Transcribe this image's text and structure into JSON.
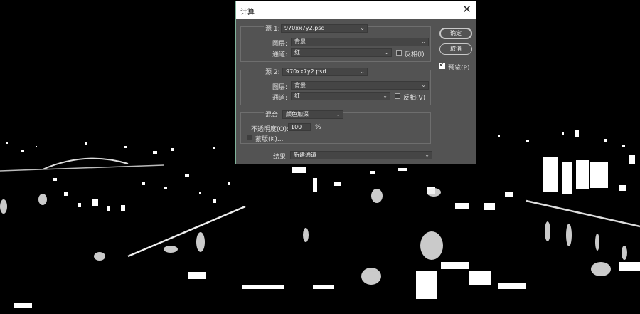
{
  "dialog": {
    "title": "计算",
    "close_glyph": "✕",
    "source1": {
      "label": "源 1:",
      "file": "970xx7y2.psd",
      "layer_label": "图层:",
      "layer": "背景",
      "channel_label": "通道:",
      "channel": "红",
      "invert_label": "反相(I)",
      "invert_checked": false
    },
    "source2": {
      "label": "源 2:",
      "file": "970xx7y2.psd",
      "layer_label": "图层:",
      "layer": "背景",
      "channel_label": "通道:",
      "channel": "红",
      "invert_label": "反相(V)",
      "invert_checked": false
    },
    "blending": {
      "label": "混合:",
      "mode": "颜色加深",
      "opacity_label": "不透明度(O):",
      "opacity": "100",
      "opacity_unit": "%",
      "mask_label": "蒙版(K)...",
      "mask_checked": false
    },
    "result": {
      "label": "结果:",
      "value": "新建通道"
    },
    "buttons": {
      "ok": "确定",
      "cancel": "取消"
    },
    "preview": {
      "label": "预览(P)",
      "checked": true
    }
  }
}
